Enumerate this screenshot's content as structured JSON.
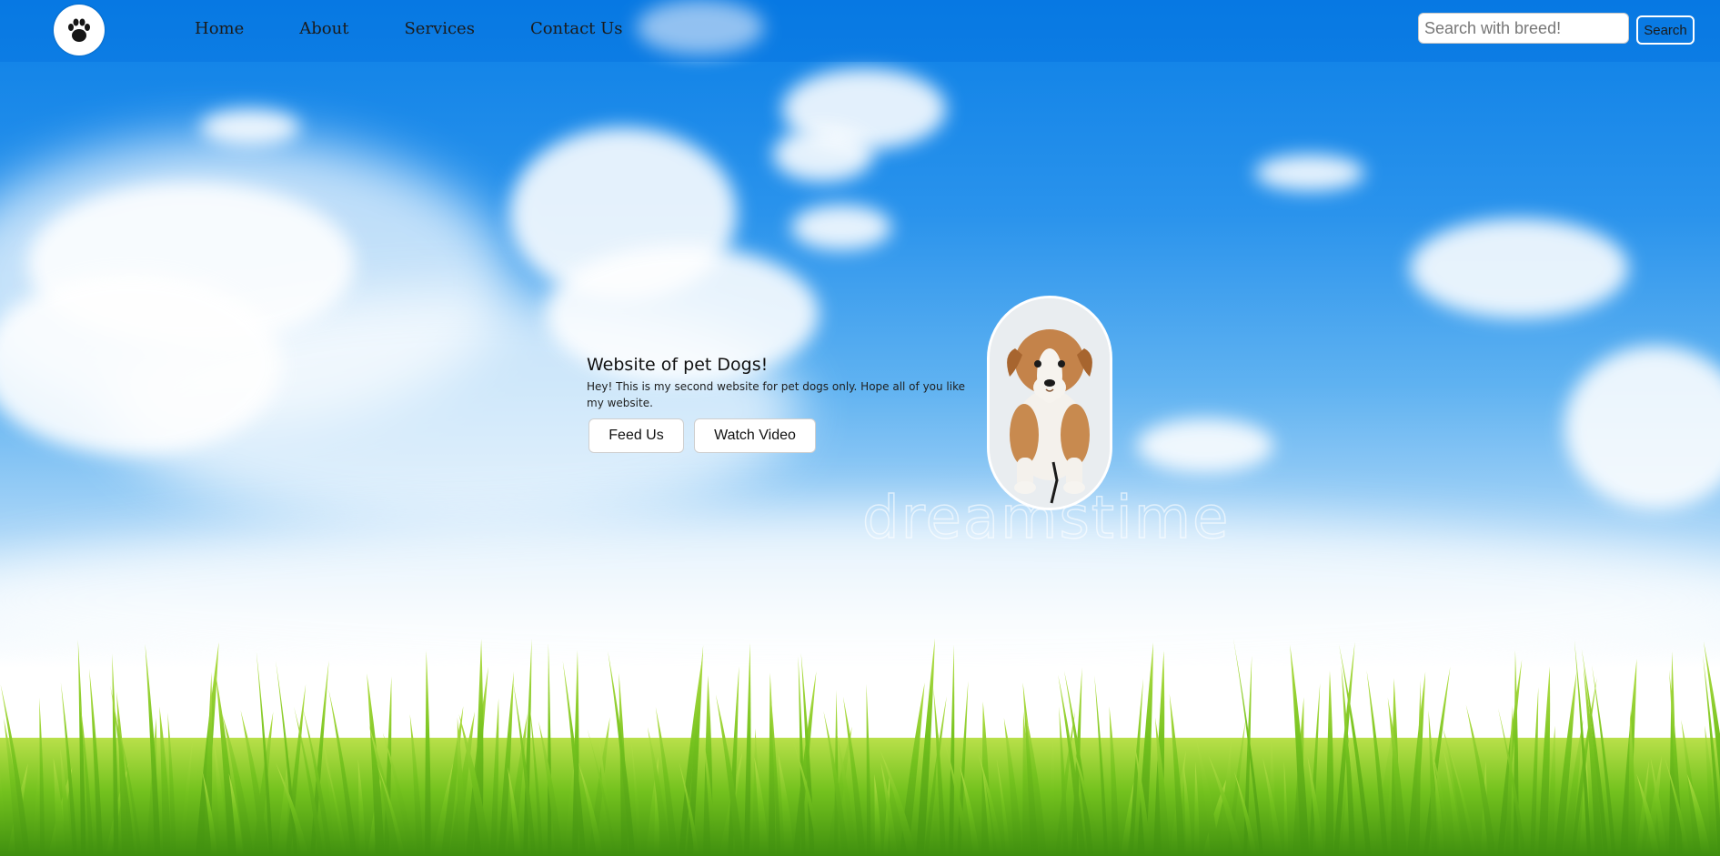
{
  "navbar": {
    "logo_icon": "paw-print-icon",
    "links": [
      "Home",
      "About",
      "Services",
      "Contact Us"
    ],
    "search": {
      "placeholder": "Search with breed!",
      "value": "",
      "button_label": "Search"
    }
  },
  "hero": {
    "title": "Website of pet Dogs!",
    "description": "Hey! This is my second website for pet dogs only. Hope all of you like my website.",
    "buttons": [
      "Feed Us",
      "Watch Video"
    ],
    "image_icon": "puppy-photo"
  },
  "background": {
    "watermark": "dreamstime",
    "sky_color": "#0b7fe6",
    "grass_color": "#6fbf1f"
  }
}
